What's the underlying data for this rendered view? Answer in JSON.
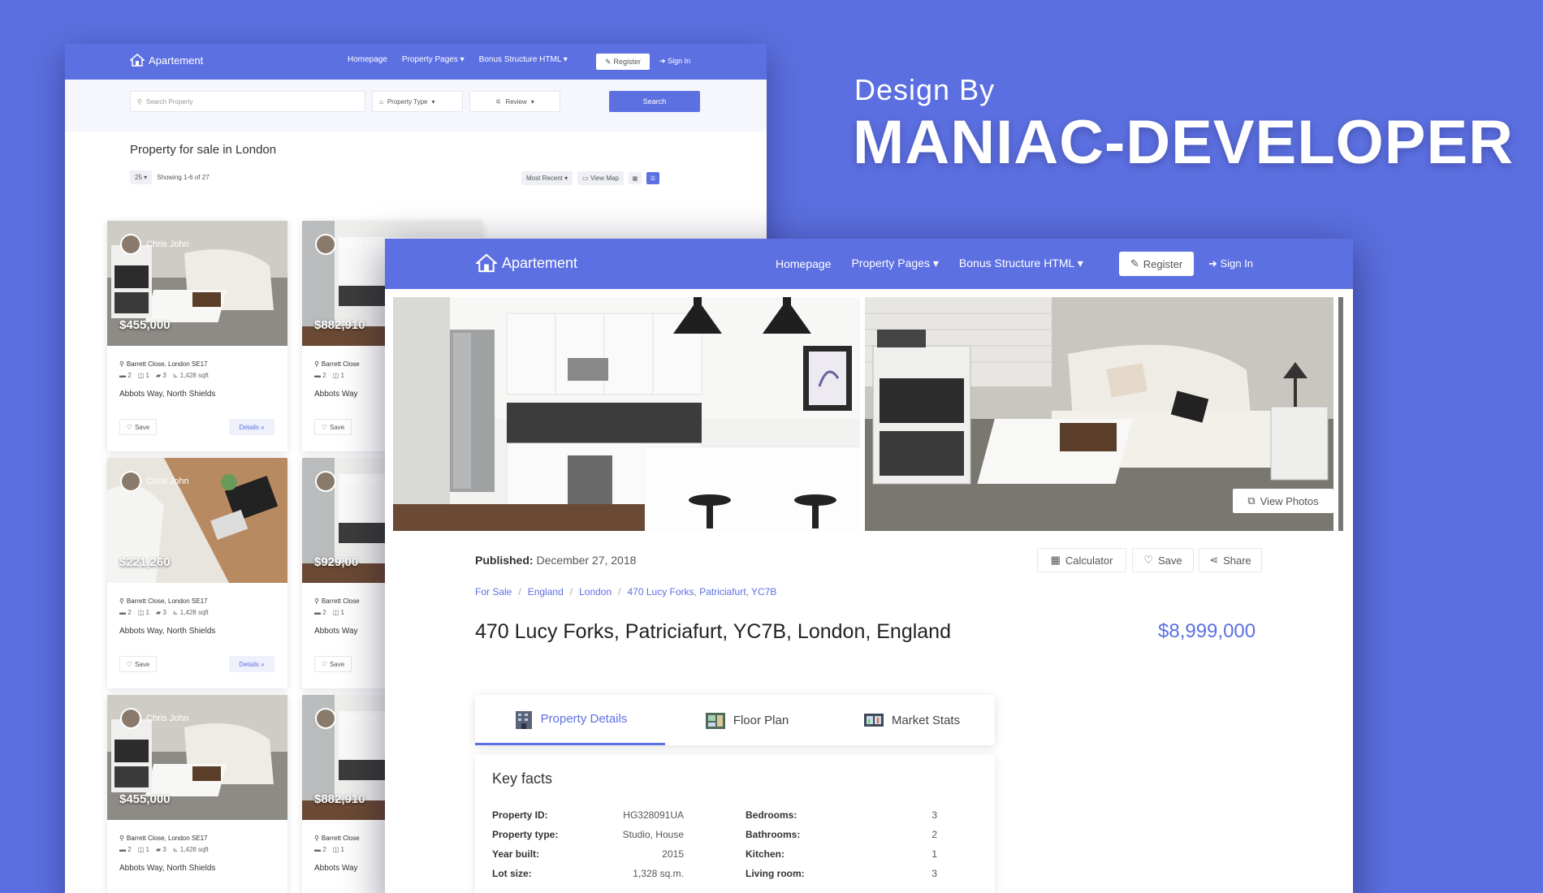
{
  "heading": {
    "design_by": "Design By",
    "author": "MANIAC-DEVELOPER"
  },
  "colors": {
    "background": "#5c6fe0",
    "accent": "#5d70e2",
    "white": "#ffffff"
  },
  "listing_page": {
    "brand": "Apartement",
    "nav": [
      "Homepage",
      "Property Pages",
      "Bonus Structure HTML"
    ],
    "register": "Register",
    "sign_in": "Sign In",
    "search_placeholder": "Search Property",
    "property_type": "Property Type",
    "review": "Review",
    "search_button": "Search",
    "page_title": "Property for sale in London",
    "per_page": "25",
    "showing": "Showing 1-6 of 27",
    "sort": "Most Recent",
    "view_map": "View Map",
    "cards": [
      {
        "agent": "Chris John",
        "price": "$455,000",
        "address": "Barrett Close, London SE17",
        "beds": "2",
        "baths": "1",
        "cars": "3",
        "area": "1,428 sqft",
        "title": "Abbots Way, North Shields",
        "save": "Save",
        "details": "Details »",
        "image": "living-room"
      },
      {
        "agent": "Chris John",
        "price": "$882,910",
        "address": "Barrett Close",
        "beds": "2",
        "baths": "1",
        "cars": "",
        "area": "",
        "title": "Abbots Way",
        "save": "Save",
        "details": "",
        "image": "kitchen"
      },
      {
        "agent": "Chris John",
        "price": "$221,260",
        "address": "Barrett Close, London SE17",
        "beds": "2",
        "baths": "1",
        "cars": "3",
        "area": "1,428 sqft",
        "title": "Abbots Way, North Shields",
        "save": "Save",
        "details": "Details »",
        "image": "desk"
      },
      {
        "agent": "Chris John",
        "price": "$929,00",
        "address": "Barrett Close",
        "beds": "2",
        "baths": "1",
        "cars": "",
        "area": "",
        "title": "Abbots Way",
        "save": "Save",
        "details": "",
        "image": "kitchen"
      },
      {
        "agent": "Chris John",
        "price": "$455,000",
        "address": "Barrett Close, London SE17",
        "beds": "2",
        "baths": "1",
        "cars": "3",
        "area": "1,428 sqft",
        "title": "Abbots Way, North Shields",
        "save": "",
        "details": "",
        "image": "living-room"
      },
      {
        "agent": "Chris John",
        "price": "$882,910",
        "address": "Barrett Close",
        "beds": "2",
        "baths": "1",
        "cars": "",
        "area": "",
        "title": "Abbots Way",
        "save": "",
        "details": "",
        "image": "kitchen"
      }
    ]
  },
  "detail_page": {
    "brand": "Apartement",
    "nav": [
      "Homepage",
      "Property Pages",
      "Bonus Structure HTML"
    ],
    "register": "Register",
    "sign_in": "Sign In",
    "view_photos": "View Photos",
    "published_label": "Published:",
    "published_date": "December 27, 2018",
    "actions": [
      "Calculator",
      "Save",
      "Share"
    ],
    "breadcrumbs": [
      "For Sale",
      "England",
      "London",
      "470 Lucy Forks, Patriciafurt, YC7B"
    ],
    "title": "470 Lucy Forks, Patriciafurt, YC7B, London, England",
    "price": "$8,999,000",
    "tabs": [
      "Property Details",
      "Floor Plan",
      "Market Stats"
    ],
    "key_facts_title": "Key facts",
    "facts_left": [
      {
        "k": "Property ID:",
        "v": "HG328091UA"
      },
      {
        "k": "Property type:",
        "v": "Studio, House"
      },
      {
        "k": "Year built:",
        "v": "2015"
      },
      {
        "k": "Lot size:",
        "v": "1,328 sq.m."
      }
    ],
    "facts_right": [
      {
        "k": "Bedrooms:",
        "v": "3"
      },
      {
        "k": "Bathrooms:",
        "v": "2"
      },
      {
        "k": "Kitchen:",
        "v": "1"
      },
      {
        "k": "Living room:",
        "v": "3"
      }
    ]
  }
}
